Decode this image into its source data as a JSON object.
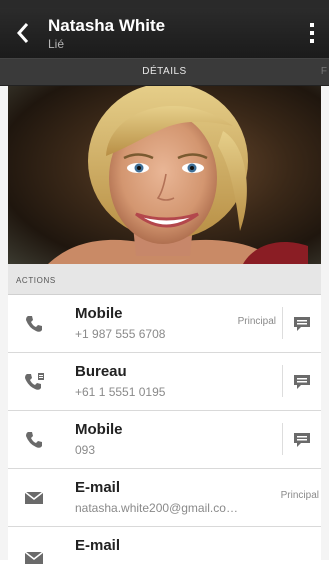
{
  "header": {
    "name": "Natasha White",
    "subtitle": "Lié"
  },
  "tabs": {
    "active": "DÉTAILS",
    "next_partial": "F"
  },
  "section": {
    "actions_label": "ACTIONS"
  },
  "contacts": [
    {
      "label": "Mobile",
      "value": "+1 987 555 6708",
      "badge": "Principal",
      "icon": "phone-icon",
      "has_message": true
    },
    {
      "label": "Bureau",
      "value": "+61 1 5551 0195",
      "badge": "",
      "icon": "work-phone-icon",
      "has_message": true
    },
    {
      "label": "Mobile",
      "value": "093",
      "badge": "",
      "icon": "phone-icon",
      "has_message": true
    },
    {
      "label": "E-mail",
      "value": "natasha.white200@gmail.co…",
      "badge": "Principal",
      "icon": "envelope-icon",
      "has_message": false
    },
    {
      "label": "E-mail",
      "value": "",
      "badge": "",
      "icon": "envelope-icon",
      "has_message": false
    }
  ],
  "colors": {
    "appbar": "#1f1f1f",
    "tabbar": "#3a3a3a",
    "icon_gray": "#6a6a6a"
  }
}
